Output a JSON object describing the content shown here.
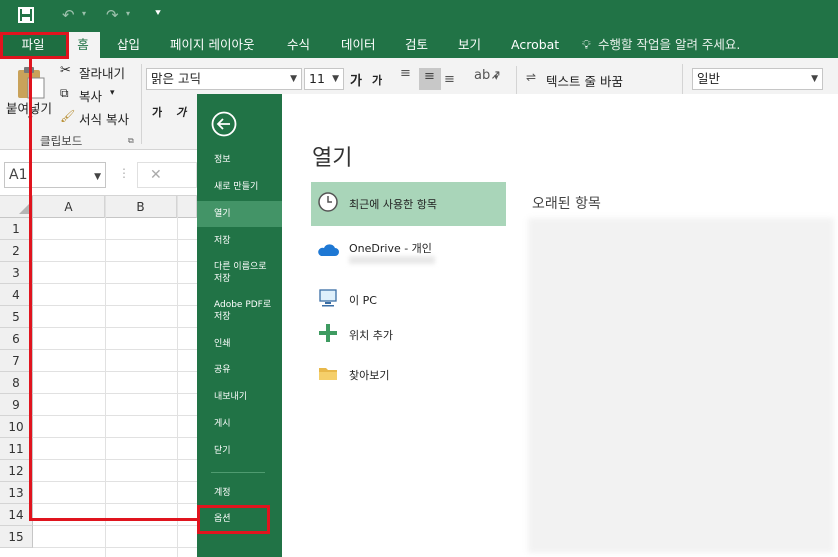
{
  "quick_access": {
    "save_icon": "save-icon",
    "undo_icon": "undo-icon",
    "redo_icon": "redo-icon",
    "customize_icon": "customize-icon"
  },
  "tabs": [
    "파일",
    "홈",
    "삽입",
    "페이지 레이아웃",
    "수식",
    "데이터",
    "검토",
    "보기",
    "Acrobat"
  ],
  "tell_me": "수행할 작업을 알려 주세요.",
  "ribbon": {
    "paste_label": "붙여넣기",
    "cut_label": "잘라내기",
    "copy_label": "복사",
    "format_painter_label": "서식 복사",
    "clipboard_group": "클립보드",
    "font_name": "맑은 고딕",
    "font_size": "11",
    "grow_font": "가",
    "shrink_font": "가",
    "wrap_text_label": "텍스트 줄 바꿈",
    "number_format": "일반"
  },
  "name_box": "A1",
  "columns": [
    "A",
    "B"
  ],
  "rows": [
    "1",
    "2",
    "3",
    "4",
    "5",
    "6",
    "7",
    "8",
    "9",
    "10",
    "11",
    "12",
    "13",
    "14",
    "15"
  ],
  "backstage": {
    "nav": [
      "정보",
      "새로 만들기",
      "열기",
      "저장",
      "다른 이름으로\n저장",
      "Adobe PDF로\n저장",
      "인쇄",
      "공유",
      "내보내기",
      "게시",
      "닫기",
      "계정",
      "옵션"
    ],
    "selected_nav": "열기",
    "title": "열기",
    "locations": [
      "최근에 사용한 항목",
      "OneDrive - 개인",
      "이 PC",
      "위치 추가",
      "찾아보기"
    ],
    "recent_heading": "오래된 항목"
  },
  "colors": {
    "excel_green": "#217346",
    "highlight_red": "#e0141e",
    "selected_location": "#a9d5b9"
  }
}
